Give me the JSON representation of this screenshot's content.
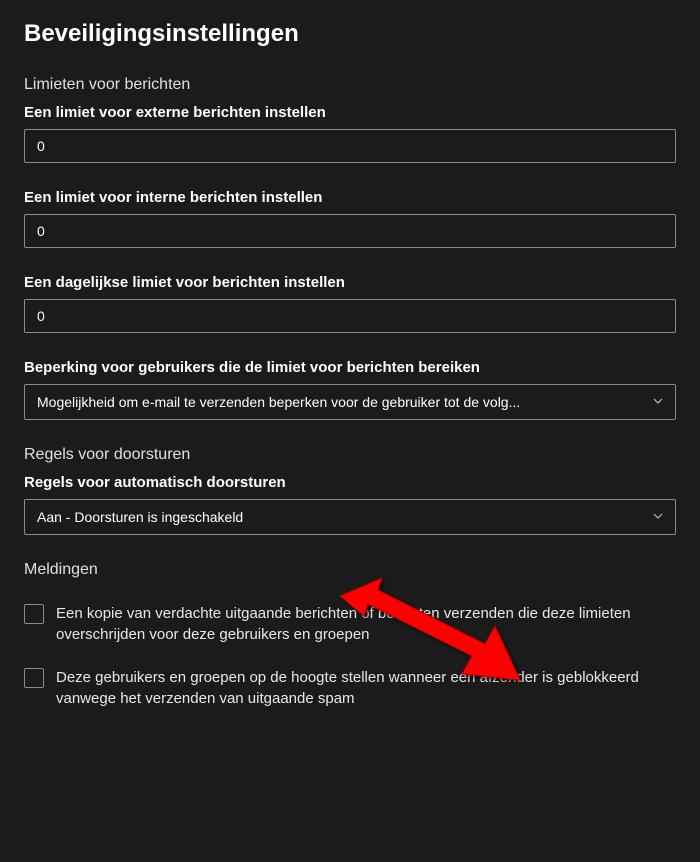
{
  "title": "Beveiligingsinstellingen",
  "limits": {
    "section_title": "Limieten voor berichten",
    "external": {
      "label": "Een limiet voor externe berichten instellen",
      "value": "0"
    },
    "internal": {
      "label": "Een limiet voor interne berichten instellen",
      "value": "0"
    },
    "daily": {
      "label": "Een dagelijkse limiet voor berichten instellen",
      "value": "0"
    },
    "restriction": {
      "label": "Beperking voor gebruikers die de limiet voor berichten bereiken",
      "selected": "Mogelijkheid om e-mail te verzenden beperken voor de gebruiker tot de volg..."
    }
  },
  "forwarding": {
    "section_title": "Regels voor doorsturen",
    "auto": {
      "label": "Regels voor automatisch doorsturen",
      "selected": "Aan - Doorsturen is ingeschakeld"
    }
  },
  "notifications": {
    "section_title": "Meldingen",
    "copy_suspicious": {
      "label": "Een kopie van verdachte uitgaande berichten of berichten verzenden die deze limieten overschrijden voor deze gebruikers en groepen"
    },
    "notify_blocked": {
      "label": "Deze gebruikers en groepen op de hoogte stellen wanneer een afzender is geblokkeerd vanwege het verzenden van uitgaande spam"
    }
  }
}
